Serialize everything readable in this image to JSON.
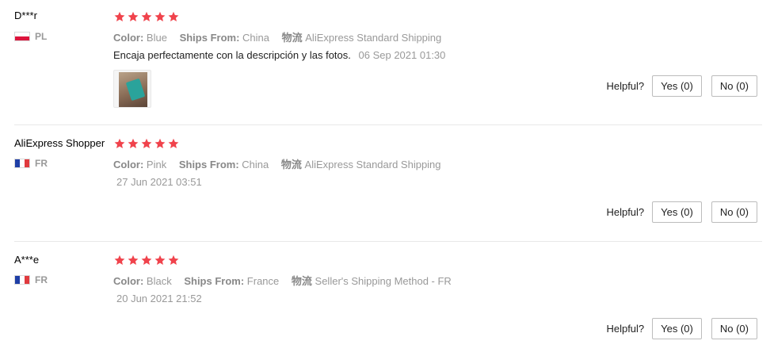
{
  "colors": {
    "star": "#f0434c",
    "muted": "#999999",
    "border": "#bcbcbc"
  },
  "reviews": [
    {
      "user": "D***r",
      "country": "PL",
      "flag": "flag-pl-icon",
      "rating": 5,
      "color_label": "Color:",
      "color_value": "Blue",
      "ships_label": "Ships From:",
      "ships_value": "China",
      "logistics_label": "物流",
      "logistics_value": "AliExpress Standard Shipping",
      "text": "Encaja perfectamente con la descripción y las fotos.",
      "date": "06 Sep 2021 01:30",
      "has_photo": true,
      "helpful_label": "Helpful?",
      "yes_label": "Yes (0)",
      "no_label": "No (0)"
    },
    {
      "user": "AliExpress Shopper",
      "country": "FR",
      "flag": "flag-fr-icon",
      "rating": 5,
      "color_label": "Color:",
      "color_value": "Pink",
      "ships_label": "Ships From:",
      "ships_value": "China",
      "logistics_label": "物流",
      "logistics_value": "AliExpress Standard Shipping",
      "text": "",
      "date": "27 Jun 2021 03:51",
      "has_photo": false,
      "helpful_label": "Helpful?",
      "yes_label": "Yes (0)",
      "no_label": "No (0)"
    },
    {
      "user": "A***e",
      "country": "FR",
      "flag": "flag-fr-icon",
      "rating": 5,
      "color_label": "Color:",
      "color_value": "Black",
      "ships_label": "Ships From:",
      "ships_value": "France",
      "logistics_label": "物流",
      "logistics_value": "Seller's Shipping Method - FR",
      "text": "",
      "date": "20 Jun 2021 21:52",
      "has_photo": false,
      "helpful_label": "Helpful?",
      "yes_label": "Yes (0)",
      "no_label": "No (0)"
    }
  ]
}
